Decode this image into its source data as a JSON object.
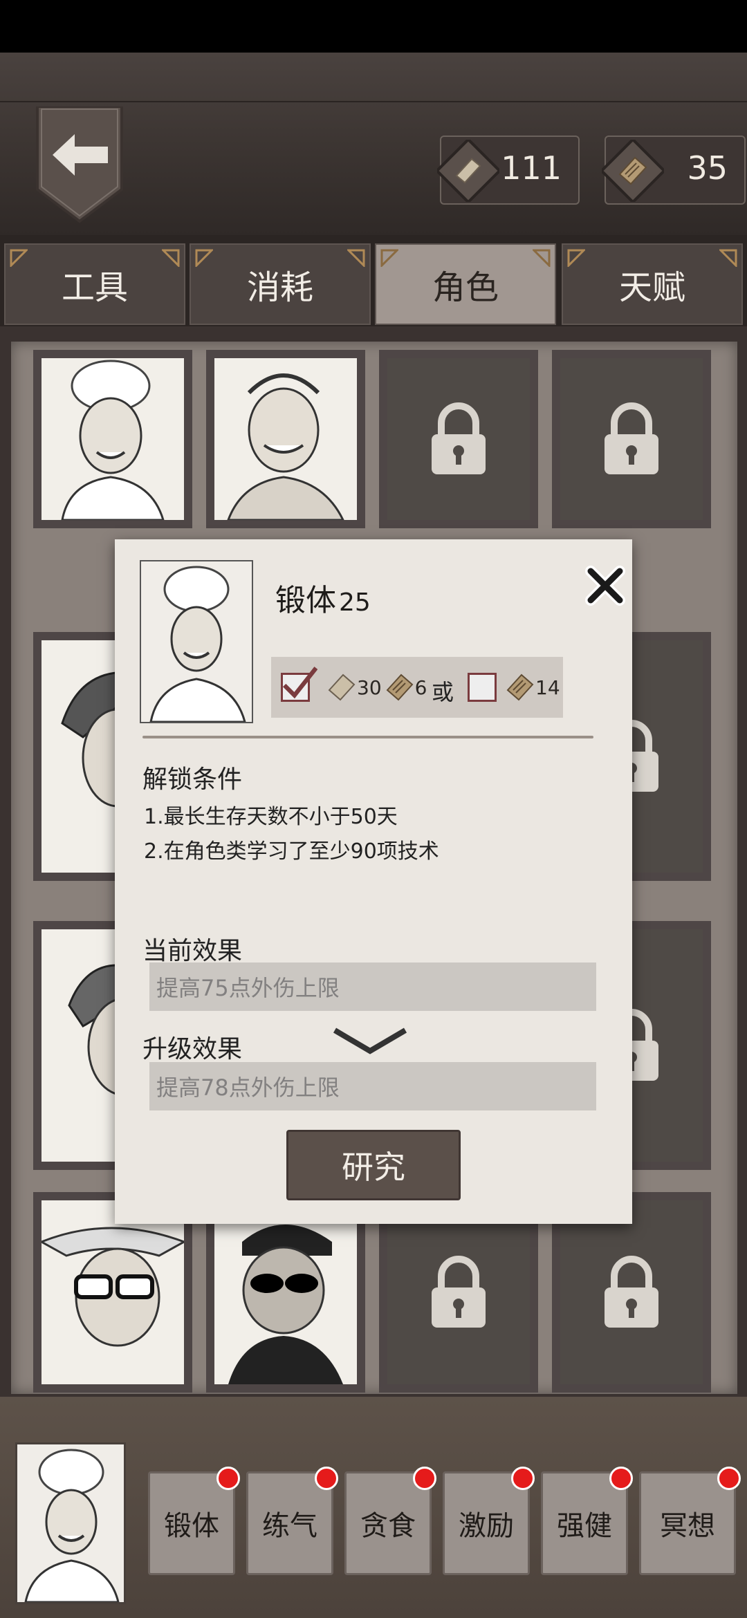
{
  "colors": {
    "accent_red": "#e51b1b",
    "tab_active": "#a19791",
    "panel": "#8a817b",
    "popup": "#ebe7e1",
    "check": "#7a3b3e"
  },
  "header": {
    "back_icon": "back-arrow-icon"
  },
  "currency": [
    {
      "icon": "paper-scroll-icon",
      "amount": "111"
    },
    {
      "icon": "book-icon",
      "amount": "35"
    }
  ],
  "tabs": [
    {
      "label": "工具",
      "active": false
    },
    {
      "label": "消耗",
      "active": false
    },
    {
      "label": "角色",
      "active": true
    },
    {
      "label": "天赋",
      "active": false
    }
  ],
  "characters": [
    {
      "name": "chef",
      "locked": false
    },
    {
      "name": "grinning-man",
      "locked": false
    },
    {
      "name": "hooded-figure",
      "locked": true
    },
    {
      "name": "bearded-man",
      "locked": true
    },
    {
      "name": "woman",
      "locked": false
    },
    {
      "name": "unknown-2",
      "locked": true
    },
    {
      "name": "unknown-3",
      "locked": true
    },
    {
      "name": "bearded-fur",
      "locked": true
    },
    {
      "name": "long-hair-man",
      "locked": false
    },
    {
      "name": "unknown-4",
      "locked": true
    },
    {
      "name": "unknown-5",
      "locked": true
    },
    {
      "name": "fur-hood",
      "locked": true
    },
    {
      "name": "sunglasses-hat",
      "locked": false
    },
    {
      "name": "sunglasses-beanie",
      "locked": false
    },
    {
      "name": "santa",
      "locked": true
    },
    {
      "name": "goggles",
      "locked": true
    }
  ],
  "popup": {
    "title": "锻体",
    "level": "25",
    "cost_a": {
      "checked": true,
      "paper": "30",
      "book": "6"
    },
    "or_label": "或",
    "cost_b": {
      "checked": false,
      "book": "14"
    },
    "unlock_title": "解锁条件",
    "conditions": [
      "1.最长生存天数不小于50天",
      "2.在角色类学习了至少90项技术"
    ],
    "current_title": "当前效果",
    "current_effect": "提高75点外伤上限",
    "upgrade_title": "升级效果",
    "upgrade_effect": "提高78点外伤上限",
    "research_label": "研究"
  },
  "skills": [
    {
      "label": "锻体",
      "badge": true
    },
    {
      "label": "练气",
      "badge": true
    },
    {
      "label": "贪食",
      "badge": true
    },
    {
      "label": "激励",
      "badge": true
    },
    {
      "label": "强健",
      "badge": true
    },
    {
      "label": "冥想",
      "badge": true
    }
  ]
}
